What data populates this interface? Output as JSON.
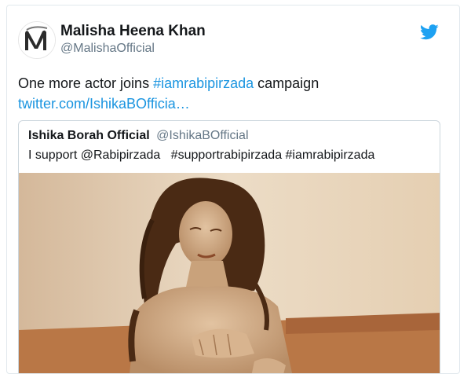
{
  "tweet": {
    "author_name": "Malisha Heena Khan",
    "author_handle": "@MalishaOfficial",
    "text_before": "One more actor joins ",
    "hashtag": "#iamrabipirzada",
    "text_after": " campaign",
    "link": "twitter.com/IshikaBOfficia…",
    "avatar_icon": "avatar-logo-icon",
    "brand_icon": "twitter-bird-icon",
    "brand_color": "#1da1f2"
  },
  "quoted_tweet": {
    "author_name": "Ishika Borah Official",
    "author_handle": "@IshikaBOfficial",
    "text": "I support @Rabipirzada   #supportrabipirzada #iamrabipirzada",
    "media_description_icon": "sepia-photo"
  },
  "colors": {
    "link": "#1b95e0",
    "text": "#14171a",
    "muted": "#657786",
    "sepia_light": "#e9d6bd",
    "sepia_mid": "#c7a27c",
    "sepia_dark": "#5b3217"
  }
}
